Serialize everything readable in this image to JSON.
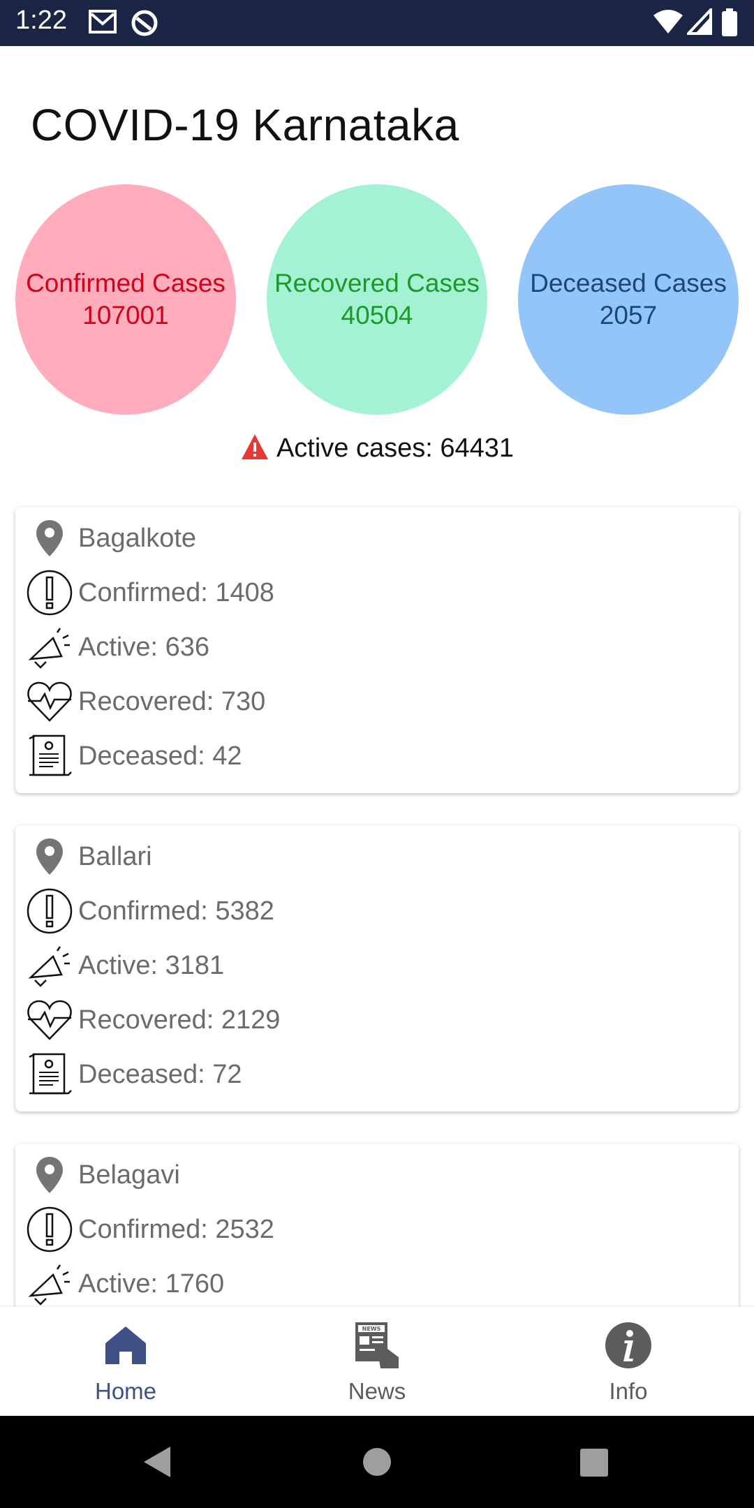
{
  "status_bar": {
    "time": "1:22"
  },
  "title": "COVID-19 Karnataka",
  "summary": {
    "confirmed": {
      "label": "Confirmed Cases",
      "value": "107001"
    },
    "recovered": {
      "label": "Recovered Cases",
      "value": "40504"
    },
    "deceased": {
      "label": "Deceased Cases",
      "value": "2057"
    },
    "active_text": "Active cases: 64431"
  },
  "districts": [
    {
      "name": "Bagalkote",
      "confirmed": "Confirmed: 1408",
      "active": "Active: 636",
      "recovered": "Recovered: 730",
      "deceased": "Deceased: 42"
    },
    {
      "name": "Ballari",
      "confirmed": "Confirmed: 5382",
      "active": "Active: 3181",
      "recovered": "Recovered: 2129",
      "deceased": "Deceased: 72"
    },
    {
      "name": "Belagavi",
      "confirmed": "Confirmed: 2532",
      "active": "Active: 1760"
    }
  ],
  "bottom_nav": {
    "home": "Home",
    "news": "News",
    "info": "Info"
  },
  "colors": {
    "confirmed_bg": "#ffadbd",
    "confirmed_text": "#d0021b",
    "recovered_bg": "#a4f2d4",
    "recovered_text": "#1b9a2b",
    "deceased_bg": "#93c5f8",
    "deceased_text": "#19487a",
    "nav_active": "#3f5184",
    "status_bar": "#1b2545"
  },
  "icons": {
    "status": [
      "gmail-icon",
      "sync-icon",
      "wifi-icon",
      "signal-icon",
      "battery-icon"
    ],
    "row": [
      "location-pin-icon",
      "exclamation-icon",
      "megaphone-icon",
      "heartbeat-icon",
      "certificate-icon"
    ],
    "nav": [
      "home-icon",
      "news-icon",
      "info-icon"
    ]
  }
}
